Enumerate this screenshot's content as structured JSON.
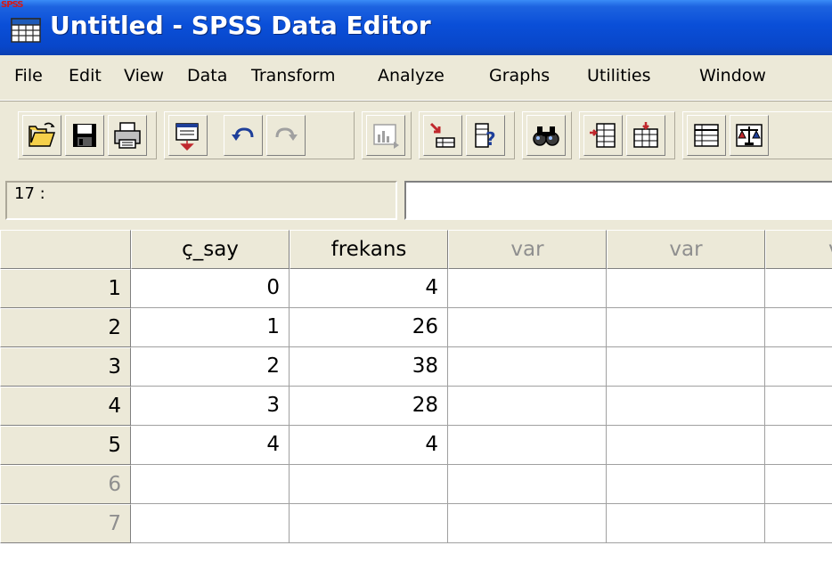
{
  "window": {
    "title": "Untitled - SPSS Data Editor",
    "icon_tag": "SPSS"
  },
  "menu": [
    "File",
    "Edit",
    "View",
    "Data",
    "Transform",
    "Analyze",
    "Graphs",
    "Utilities",
    "Window"
  ],
  "toolbar": {
    "groups": [
      [
        "open-icon",
        "save-icon",
        "print-icon"
      ],
      [
        "dialog-recall-icon",
        "undo-icon",
        "redo-icon"
      ],
      [
        "goto-chart-icon"
      ],
      [
        "goto-case-icon",
        "variables-icon"
      ],
      [
        "find-icon"
      ],
      [
        "insert-case-icon",
        "insert-variable-icon"
      ],
      [
        "split-file-icon",
        "weight-cases-icon"
      ]
    ]
  },
  "cell_editor": {
    "reference": "17 :",
    "value": ""
  },
  "grid": {
    "columns": [
      "ç_say",
      "frekans",
      "var",
      "var",
      "var"
    ],
    "rows": [
      {
        "num": "1",
        "cells": [
          "0",
          "4"
        ]
      },
      {
        "num": "2",
        "cells": [
          "1",
          "26"
        ]
      },
      {
        "num": "3",
        "cells": [
          "2",
          "38"
        ]
      },
      {
        "num": "4",
        "cells": [
          "3",
          "28"
        ]
      },
      {
        "num": "5",
        "cells": [
          "4",
          "4"
        ]
      },
      {
        "num": "6",
        "cells": [
          "",
          ""
        ]
      },
      {
        "num": "7",
        "cells": [
          "",
          ""
        ]
      }
    ]
  },
  "colors": {
    "title_bar": "#0A4FD8",
    "chrome": "#ECE9D8",
    "dim_text": "#8F8F8F"
  }
}
